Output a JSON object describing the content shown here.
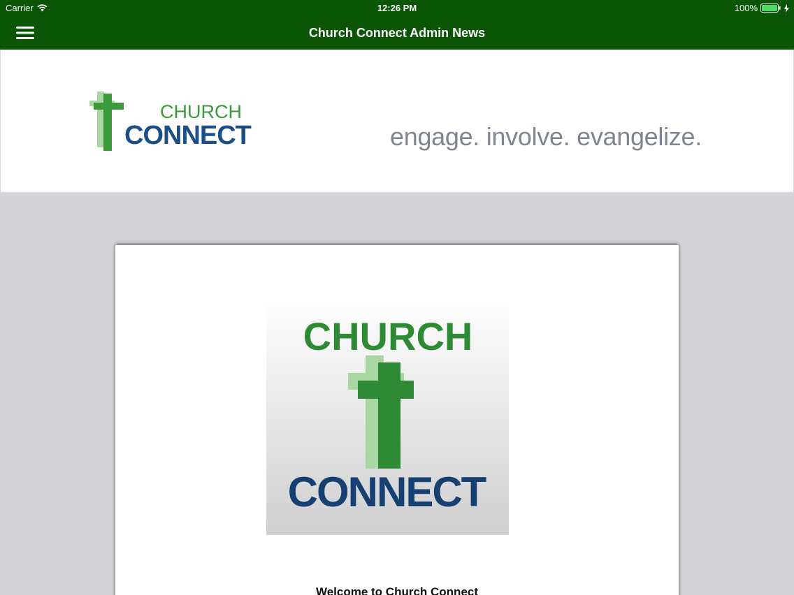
{
  "status_bar": {
    "carrier": "Carrier",
    "time": "12:26 PM",
    "battery": "100%"
  },
  "nav": {
    "title": "Church Connect Admin News",
    "menu_icon": "hamburger-menu-icon"
  },
  "banner": {
    "logo_word_top": "CHURCH",
    "logo_word_bottom": "CONNECT",
    "tagline": "engage. involve. evangelize."
  },
  "content": {
    "image_word_top": "CHURCH",
    "image_word_bottom": "CONNECT",
    "welcome": "Welcome to Church Connect"
  },
  "colors": {
    "nav_green": "#0b5506",
    "logo_green": "#3a9a3a",
    "logo_blue": "#1b4f85",
    "page_gray": "#d5d4d8"
  }
}
